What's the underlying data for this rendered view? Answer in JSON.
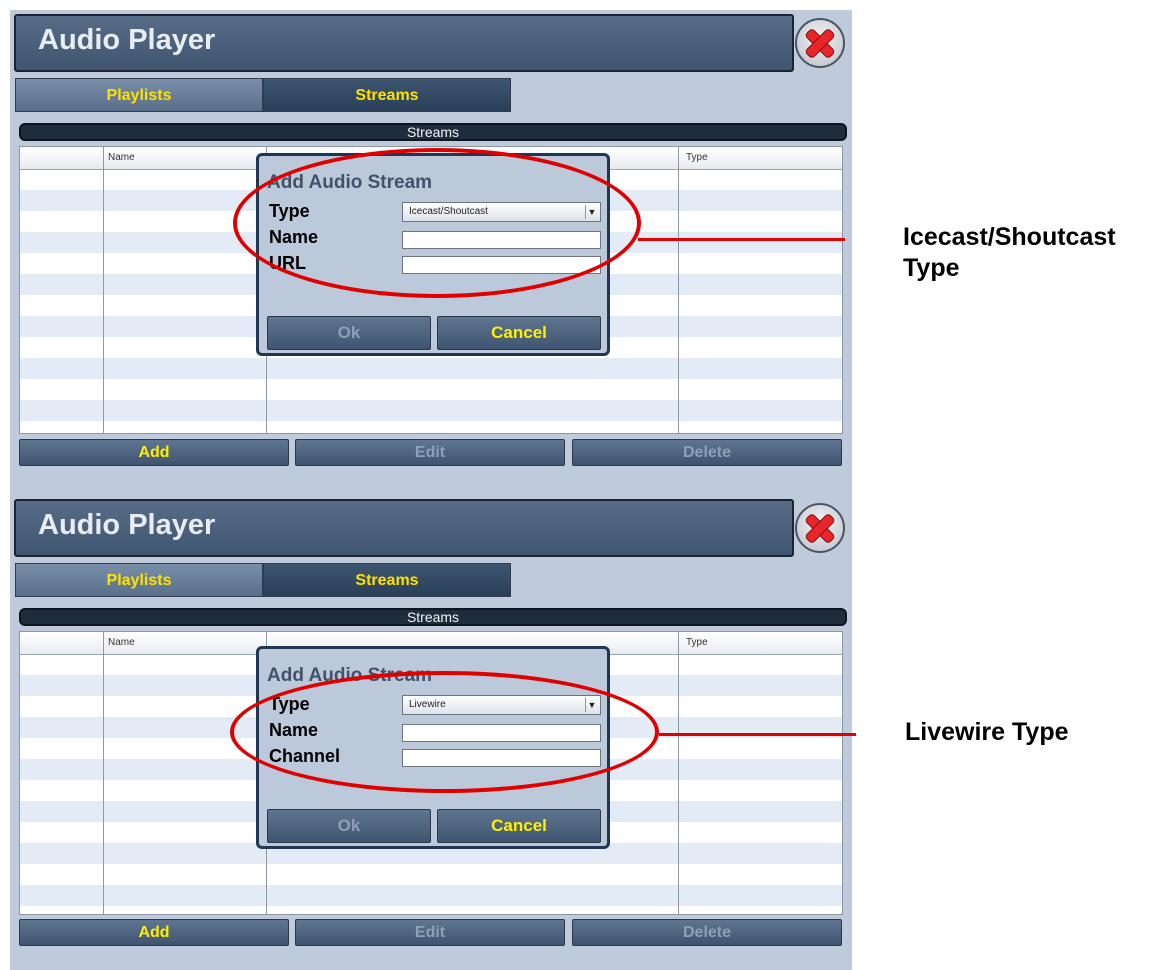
{
  "screens": [
    {
      "app_title": "Audio Player",
      "tabs": [
        "Playlists",
        "Streams"
      ],
      "section_title": "Streams",
      "table_headers": [
        "Name",
        "Type"
      ],
      "buttons": {
        "add": "Add",
        "edit": "Edit",
        "delete": "Delete"
      },
      "dialog": {
        "title": "Add Audio Stream",
        "fields": [
          "Type",
          "Name",
          "URL"
        ],
        "type_value": "Icecast/Shoutcast",
        "ok": "Ok",
        "cancel": "Cancel"
      },
      "callout": [
        "Icecast/Shoutcast",
        "Type"
      ]
    },
    {
      "app_title": "Audio Player",
      "tabs": [
        "Playlists",
        "Streams"
      ],
      "section_title": "Streams",
      "table_headers": [
        "Name",
        "Type"
      ],
      "buttons": {
        "add": "Add",
        "edit": "Edit",
        "delete": "Delete"
      },
      "dialog": {
        "title": "Add Audio Stream",
        "fields": [
          "Type",
          "Name",
          "Channel"
        ],
        "type_value": "Livewire",
        "ok": "Ok",
        "cancel": "Cancel"
      },
      "callout": [
        "Livewire Type"
      ]
    }
  ],
  "colors": {
    "accent_yellow": "#fff000",
    "highlight_red": "#e00000",
    "panel_bg": "#bfcbdb",
    "header_bg": "#4a5f7b"
  },
  "icons": {
    "close": "close-icon"
  }
}
